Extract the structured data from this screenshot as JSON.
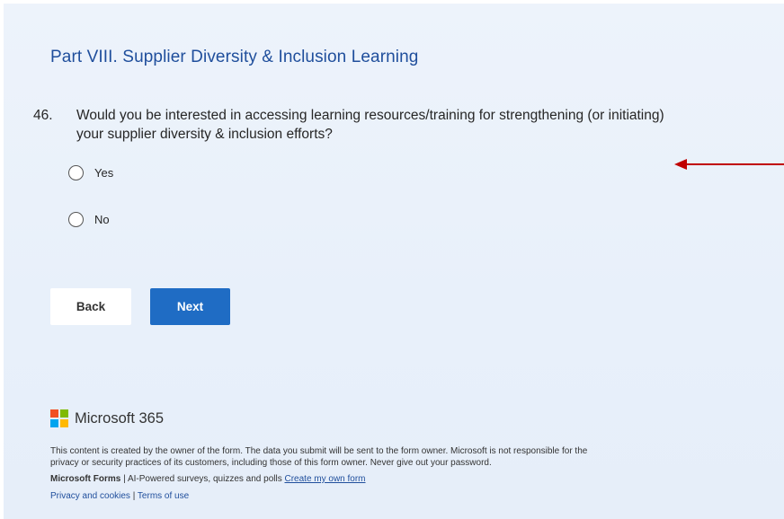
{
  "section": {
    "title": "Part VIII. Supplier Diversity & Inclusion Learning"
  },
  "question": {
    "number": "46.",
    "text_line1": "Would you be interested in accessing learning resources/training for strengthening (or initiating)",
    "text_line2": "your supplier diversity & inclusion efforts?",
    "options": [
      "Yes",
      "No"
    ]
  },
  "annotation": {
    "arrow_color": "#c00000"
  },
  "buttons": {
    "back_label": "Back",
    "next_label": "Next"
  },
  "brand": {
    "logo_text": "Microsoft 365",
    "logo_colors": [
      "#f25022",
      "#7fba00",
      "#00a4ef",
      "#ffb900"
    ]
  },
  "footer": {
    "disclaimer_line1": "This content is created by the owner of the form. The data you submit will be sent to the form owner. Microsoft is not responsible for the",
    "disclaimer_line2": "privacy or security practices of its customers, including those of this form owner. Never give out your password.",
    "product_name": "Microsoft Forms",
    "product_tagline": " | AI-Powered surveys, quizzes and polls ",
    "create_link": "Create my own form",
    "privacy_link": "Privacy and cookies",
    "separator": " | ",
    "terms_link": "Terms of use"
  },
  "colors": {
    "accent": "#1f6cc4",
    "title": "#1f4e9c"
  }
}
